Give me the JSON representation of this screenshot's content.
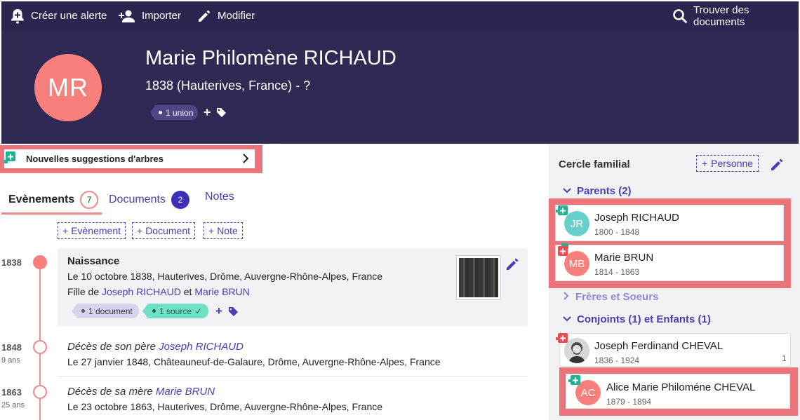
{
  "toolbar": {
    "create_alert": "Créer une alerte",
    "import": "Importer",
    "edit": "Modifier",
    "find_documents": "Trouver des documents"
  },
  "header": {
    "initials": "MR",
    "name": "Marie Philomène RICHAUD",
    "subtitle": "1838 (Hauterives, France) - ?",
    "union_tag": "1 union"
  },
  "suggestions": {
    "label": "Nouvelles suggestions d'arbres"
  },
  "tabs": [
    {
      "label": "Evènements",
      "count": "7"
    },
    {
      "label": "Documents",
      "count": "2"
    },
    {
      "label": "Notes"
    }
  ],
  "add_buttons": [
    "Evènement",
    "Document",
    "Note"
  ],
  "events": [
    {
      "year": "1838",
      "title": "Naissance",
      "line1": "Le 10 octobre 1838, Hauterives, Drôme, Auvergne-Rhône-Alpes, France",
      "line2_prefix": "Fille de ",
      "father": "Joseph RICHAUD",
      "line2_mid": " et ",
      "mother": "Marie BRUN",
      "tag_document": "1 document",
      "tag_source": "1 source"
    },
    {
      "year": "1848",
      "age": "9 ans",
      "title_prefix": "Décès de son père ",
      "title_link": "Joseph RICHAUD",
      "line1": "Le 27 janvier 1848, Châteauneuf-de-Galaure, Drôme, Auvergne-Rhône-Alpes, France"
    },
    {
      "year": "1863",
      "age": "25 ans",
      "title_prefix": "Décès de sa mère ",
      "title_link": "Marie BRUN",
      "line1": "Le 23 octobre 1863, Hauterives, Drôme, Auvergne-Rhône-Alpes, France"
    }
  ],
  "family": {
    "title": "Cercle familial",
    "add_person": "Personne",
    "parents_header": "Parents (2)",
    "parents": [
      {
        "initials": "JR",
        "name": "Joseph RICHAUD",
        "dates": "1800 - 1848"
      },
      {
        "initials": "MB",
        "name": "Marie BRUN",
        "dates": "1814 - 1863"
      }
    ],
    "siblings_header": "Frères et Soeurs",
    "spouses_header": "Conjoints (1) et Enfants (1)",
    "spouse": {
      "name": "Joseph Ferdinand CHEVAL",
      "dates": "1836 - 1924",
      "count": "1"
    },
    "child": {
      "initials": "AC",
      "name": "Alice Marie Philoméne CHEVAL",
      "dates": "1879 - 1894"
    }
  },
  "colors": {
    "toolbar_bg": "#2b2550",
    "header_bg": "#2f2954",
    "accent": "#4b3bb5",
    "highlight_frame": "#ea747a",
    "avatar_female": "#f7807c",
    "avatar_male": "#66cfc9",
    "badge_green": "#1fb394",
    "badge_red": "#f0484e"
  }
}
